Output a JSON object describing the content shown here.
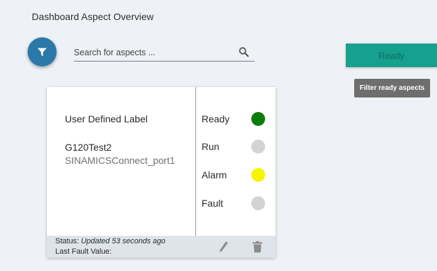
{
  "header": {
    "title": "Dashboard Aspect Overview"
  },
  "toolbar": {
    "filter_icon": "filter-icon",
    "search": {
      "placeholder": "Search for aspects ...",
      "value": "",
      "icon": "search-icon"
    },
    "ready_button_label": "Ready",
    "tooltip": "Filter ready aspects"
  },
  "colors": {
    "accent": "#2b79a8",
    "ready_button": "#16a08e",
    "status_ready": "#0a7d0a",
    "status_inactive": "#d3d3d3",
    "status_alarm": "#f5f500"
  },
  "card": {
    "label": "User Defined Label",
    "device_name": "G120Test2",
    "device_port": "SINAMICSConnect_port1",
    "statuses": [
      {
        "label": "Ready",
        "state": "active",
        "color": "#0a7d0a"
      },
      {
        "label": "Run",
        "state": "inactive",
        "color": "#d3d3d3"
      },
      {
        "label": "Alarm",
        "state": "active",
        "color": "#f5f500"
      },
      {
        "label": "Fault",
        "state": "inactive",
        "color": "#d3d3d3"
      }
    ],
    "footer": {
      "status_label": "Status:",
      "status_value": "Updated 53 seconds ago",
      "fault_label": "Last Fault Value:",
      "fault_value": ""
    },
    "edit_icon": "pencil-icon",
    "delete_icon": "trash-icon"
  }
}
